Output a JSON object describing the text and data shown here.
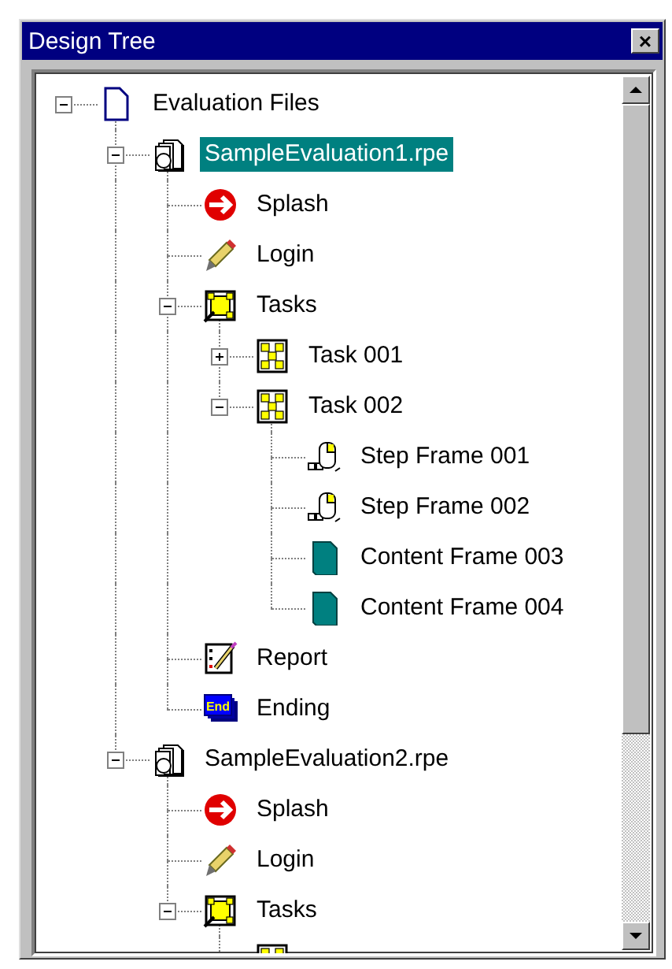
{
  "window": {
    "title": "Design Tree",
    "close": "×"
  },
  "tree": [
    {
      "kind": "root",
      "label": "Evaluation Files",
      "expanded": true,
      "selected": false,
      "children": [
        {
          "kind": "evaluation",
          "label": "SampleEvaluation1.rpe",
          "expanded": true,
          "selected": true,
          "children": [
            {
              "kind": "splash",
              "label": "Splash",
              "selected": false
            },
            {
              "kind": "login",
              "label": "Login",
              "selected": false
            },
            {
              "kind": "tasks",
              "label": "Tasks",
              "expanded": true,
              "selected": false,
              "children": [
                {
                  "kind": "task",
                  "label": "Task 001",
                  "expanded": false,
                  "selected": false
                },
                {
                  "kind": "task",
                  "label": "Task 002",
                  "expanded": true,
                  "selected": false,
                  "children": [
                    {
                      "kind": "step_frame",
                      "label": "Step Frame 001",
                      "selected": false
                    },
                    {
                      "kind": "step_frame",
                      "label": "Step Frame 002",
                      "selected": false
                    },
                    {
                      "kind": "content_frame",
                      "label": "Content Frame 003",
                      "selected": false
                    },
                    {
                      "kind": "content_frame",
                      "label": "Content Frame 004",
                      "selected": false
                    }
                  ]
                }
              ]
            },
            {
              "kind": "report",
              "label": "Report",
              "selected": false
            },
            {
              "kind": "ending",
              "label": "Ending",
              "icon_text": "End",
              "selected": false
            }
          ]
        },
        {
          "kind": "evaluation",
          "label": "SampleEvaluation2.rpe",
          "expanded": true,
          "selected": false,
          "children": [
            {
              "kind": "splash",
              "label": "Splash",
              "selected": false
            },
            {
              "kind": "login",
              "label": "Login",
              "selected": false
            },
            {
              "kind": "tasks",
              "label": "Tasks",
              "expanded": true,
              "selected": false,
              "children": [
                {
                  "kind": "task"
                }
              ]
            }
          ]
        }
      ]
    }
  ]
}
